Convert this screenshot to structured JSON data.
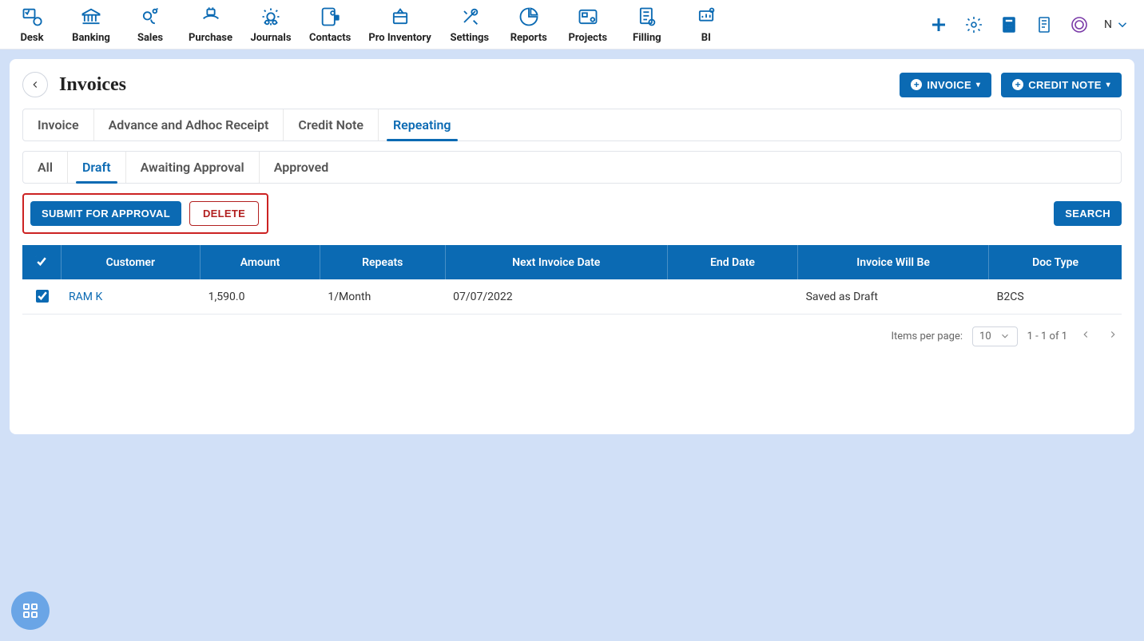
{
  "nav": {
    "items": [
      {
        "label": "Desk"
      },
      {
        "label": "Banking"
      },
      {
        "label": "Sales"
      },
      {
        "label": "Purchase"
      },
      {
        "label": "Journals"
      },
      {
        "label": "Contacts"
      },
      {
        "label": "Pro Inventory"
      },
      {
        "label": "Settings"
      },
      {
        "label": "Reports"
      },
      {
        "label": "Projects"
      },
      {
        "label": "Filling"
      },
      {
        "label": "BI"
      }
    ],
    "user_initial": "N"
  },
  "page": {
    "title": "Invoices",
    "actions": {
      "invoice_btn": "INVOICE",
      "credit_note_btn": "CREDIT NOTE"
    }
  },
  "doc_tabs": {
    "items": [
      {
        "label": "Invoice"
      },
      {
        "label": "Advance and Adhoc Receipt"
      },
      {
        "label": "Credit Note"
      },
      {
        "label": "Repeating",
        "active": true
      }
    ]
  },
  "status_tabs": {
    "items": [
      {
        "label": "All"
      },
      {
        "label": "Draft",
        "active": true
      },
      {
        "label": "Awaiting Approval"
      },
      {
        "label": "Approved"
      }
    ]
  },
  "actionbar": {
    "submit": "SUBMIT FOR APPROVAL",
    "delete": "DELETE",
    "search": "SEARCH"
  },
  "table": {
    "headers": [
      "Customer",
      "Amount",
      "Repeats",
      "Next Invoice Date",
      "End Date",
      "Invoice Will Be",
      "Doc Type"
    ],
    "rows": [
      {
        "checked": true,
        "customer": "RAM K",
        "amount": "1,590.0",
        "repeats": "1/Month",
        "next_invoice": "07/07/2022",
        "end_date": "",
        "invoice_will_be": "Saved as Draft",
        "doc_type": "B2CS"
      }
    ]
  },
  "paginator": {
    "label": "Items per page:",
    "per_page": "10",
    "range": "1 - 1 of 1"
  }
}
